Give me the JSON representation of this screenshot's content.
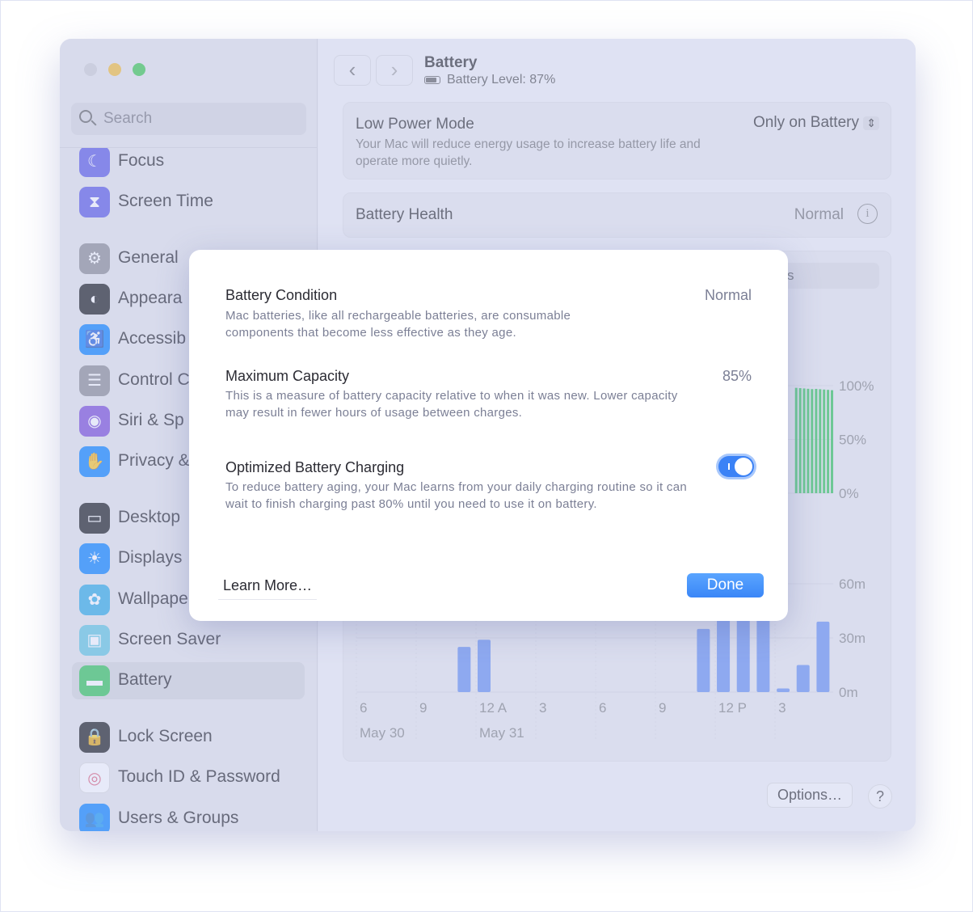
{
  "window": {
    "traffic_lights": [
      "close",
      "minimize",
      "zoom"
    ]
  },
  "sidebar": {
    "search_placeholder": "Search",
    "items": [
      {
        "label": "Focus",
        "icon": "moon-icon",
        "color": "#5e5ce6"
      },
      {
        "label": "Screen Time",
        "icon": "hourglass-icon",
        "color": "#5e5ce6"
      },
      {
        "label": "General",
        "icon": "gear-icon",
        "color": "#8e8e93"
      },
      {
        "label": "Appeara",
        "icon": "appearance-icon",
        "color": "#1c1c1e"
      },
      {
        "label": "Accessib",
        "icon": "accessibility-icon",
        "color": "#0a84ff"
      },
      {
        "label": "Control C",
        "icon": "toggles-icon",
        "color": "#8e8e93"
      },
      {
        "label": "Siri & Sp",
        "icon": "siri-icon",
        "color": "#7d4fd8"
      },
      {
        "label": "Privacy &",
        "icon": "hand-icon",
        "color": "#0a84ff"
      },
      {
        "label": "Desktop",
        "icon": "dock-icon",
        "color": "#1c1c1e"
      },
      {
        "label": "Displays",
        "icon": "sun-icon",
        "color": "#0a84ff"
      },
      {
        "label": "Wallpape",
        "icon": "flower-icon",
        "color": "#32ade6"
      },
      {
        "label": "Screen Saver",
        "icon": "screensaver-icon",
        "color": "#64c8e0"
      },
      {
        "label": "Battery",
        "icon": "battery-icon",
        "color": "#34c759",
        "selected": true
      },
      {
        "label": "Lock Screen",
        "icon": "lock-icon",
        "color": "#1c1c1e"
      },
      {
        "label": "Touch ID & Password",
        "icon": "fingerprint-icon",
        "color": "#ffffff"
      },
      {
        "label": "Users & Groups",
        "icon": "users-icon",
        "color": "#0a84ff"
      }
    ]
  },
  "header": {
    "title": "Battery",
    "subtitle": "Battery Level: 87%",
    "battery_level": 87
  },
  "low_power": {
    "title": "Low Power Mode",
    "description": "Your Mac will reduce energy usage to increase battery life and operate more quietly.",
    "value": "Only on Battery"
  },
  "health": {
    "title": "Battery Health",
    "value": "Normal"
  },
  "segment_tail": "s",
  "footer": {
    "options": "Options…",
    "help": "?"
  },
  "chart_data": [
    {
      "type": "bar",
      "title": "",
      "y_ticks": [
        "100%",
        "50%",
        "0%"
      ],
      "ylim": [
        0,
        100
      ],
      "x_hours_from_6pm_may30": [
        22,
        23
      ],
      "values": [
        98,
        97
      ],
      "color": "#34c759"
    },
    {
      "type": "bar",
      "title": "",
      "y_ticks": [
        "60m",
        "30m",
        "0m"
      ],
      "ylim": [
        0,
        60
      ],
      "x_tick_labels": [
        "6",
        "9",
        "12 A",
        "3",
        "6",
        "9",
        "12 P",
        "3"
      ],
      "date_labels": [
        "May 30",
        "May 31"
      ],
      "hours": [
        "11 PM",
        "12 AM",
        "11 AM",
        "12 PM",
        "1 PM",
        "2 PM",
        "3 PM",
        "4 PM",
        "5 PM"
      ],
      "values": [
        25,
        29,
        35,
        45,
        45,
        45,
        2,
        15,
        39
      ],
      "color": "#6b93f0"
    }
  ],
  "modal": {
    "rows": [
      {
        "title": "Battery Condition",
        "value": "Normal",
        "description": "Mac batteries, like all rechargeable batteries, are consumable components that become less effective as they age."
      },
      {
        "title": "Maximum Capacity",
        "value": "85%",
        "description": "This is a measure of battery capacity relative to when it was new. Lower capacity may result in fewer hours of usage between charges."
      },
      {
        "title": "Optimized Battery Charging",
        "toggle_on": true,
        "description": "To reduce battery aging, your Mac learns from your daily charging routine so it can wait to finish charging past 80% until you need to use it on battery."
      }
    ],
    "learn_more": "Learn More…",
    "done": "Done"
  }
}
